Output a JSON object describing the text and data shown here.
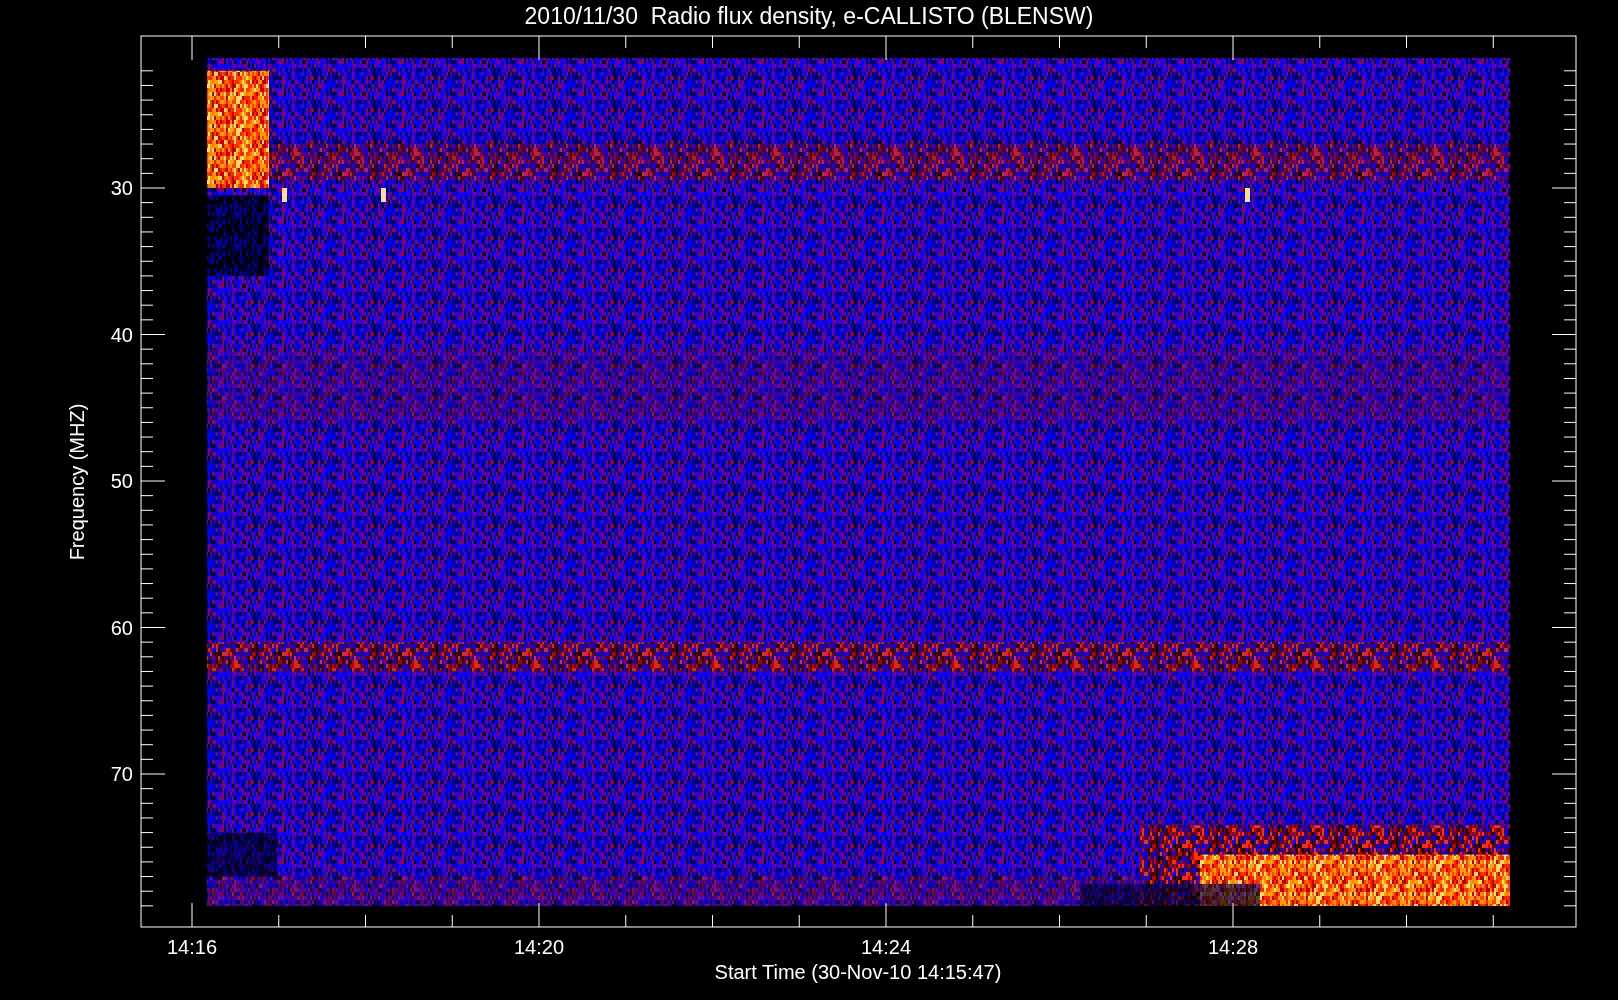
{
  "title": "2010/11/30  Radio flux density, e-CALLISTO (BLENSW)",
  "y_axis": {
    "label": "Frequency (MHZ)",
    "ticks": [
      "30",
      "40",
      "50",
      "60",
      "70"
    ]
  },
  "x_axis": {
    "label": "Start Time (30-Nov-10 14:15:47)",
    "ticks": [
      "14:16",
      "14:20",
      "14:24",
      "14:28"
    ]
  }
}
